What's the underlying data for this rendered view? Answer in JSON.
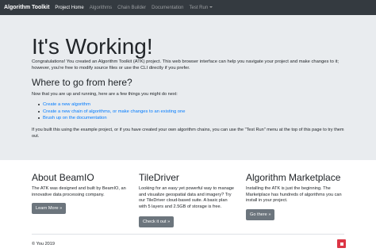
{
  "navbar": {
    "brand": "Algorithm Toolkit",
    "items": [
      {
        "label": "Project Home",
        "active": true
      },
      {
        "label": "Algorithms",
        "active": false
      },
      {
        "label": "Chain Builder",
        "active": false
      },
      {
        "label": "Documentation",
        "active": false
      },
      {
        "label": "Test Run",
        "active": false,
        "dropdown": true
      }
    ]
  },
  "hero": {
    "title": "It's Working!",
    "lead": "Congratulations! You created an Algorithm Toolkit (ATK) project. This web browser interface can help you navigate your project and make changes to it; however, you're free to modify source files or use the CLI directly if you prefer.",
    "subtitle": "Where to go from here?",
    "intro": "Now that you are up and running, here are a few things you might do next:",
    "links": [
      "Create a new algorithm",
      "Create a new chain of algorithms, or make changes to an existing one",
      "Brush up on the documentation"
    ],
    "outro": "If you built this using the example project, or if you have created your own algorithm chains, you can use the \"Test Run\" menu at the top of this page to try them out."
  },
  "columns": [
    {
      "title": "About BeamIO",
      "text": "The ATK was designed and built by BeamIO, an innovative data processing company.",
      "button": "Learn More »"
    },
    {
      "title": "TileDriver",
      "text": "Looking for an easy yet powerful way to manage and visualize geospatial data and imagery? Try our TileDriver cloud-based suite. A basic plan with 5 layers and 2.5GB of storage is free.",
      "button": "Check it out »"
    },
    {
      "title": "Algorithm Marketplace",
      "text": "Installing the ATK is just the beginning. The Marketplace has hundreds of algorithms you can install in your project.",
      "button": "Go there »"
    }
  ],
  "footer": {
    "text": "© You 2019"
  },
  "colors": {
    "navbar_bg": "#343a40",
    "jumbotron_bg": "#e9ecef",
    "link": "#007bff",
    "button_bg": "#6c757d",
    "badge": "#dc3545"
  }
}
